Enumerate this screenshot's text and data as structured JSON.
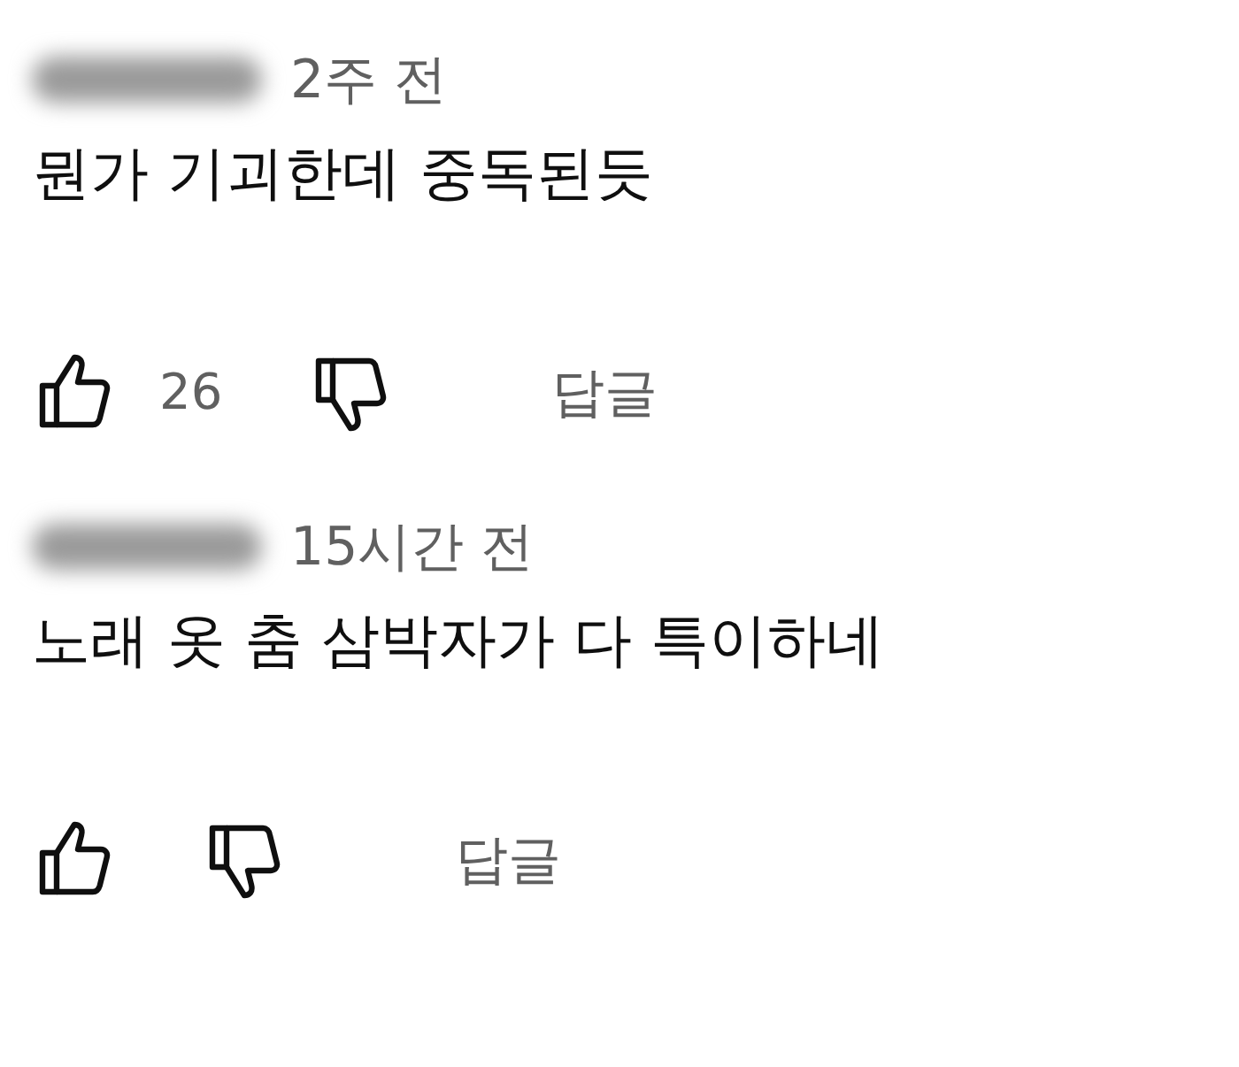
{
  "comments": [
    {
      "time": "2주 전",
      "text": "뭔가 기괴한데 중독된듯",
      "likes": "26",
      "reply": "답글"
    },
    {
      "time": "15시간 전",
      "text": "노래 옷 춤 삼박자가 다 특이하네",
      "reply": "답글"
    }
  ]
}
